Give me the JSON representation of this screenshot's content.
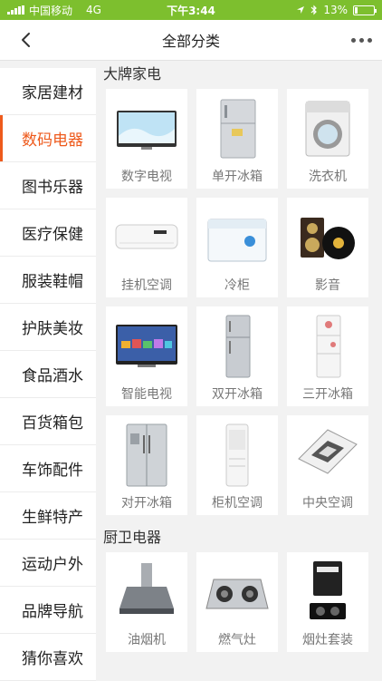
{
  "status_bar": {
    "carrier": "中国移动",
    "network": "4G",
    "time": "下午3:44",
    "battery": "13%",
    "battery_level": 0.13
  },
  "header": {
    "title": "全部分类"
  },
  "sidebar": {
    "items": [
      {
        "label": "家居建材"
      },
      {
        "label": "数码电器"
      },
      {
        "label": "图书乐器"
      },
      {
        "label": "医疗保健"
      },
      {
        "label": "服装鞋帽"
      },
      {
        "label": "护肤美妆"
      },
      {
        "label": "食品酒水"
      },
      {
        "label": "百货箱包"
      },
      {
        "label": "车饰配件"
      },
      {
        "label": "生鲜特产"
      },
      {
        "label": "运动户外"
      },
      {
        "label": "品牌导航"
      },
      {
        "label": "猜你喜欢"
      }
    ],
    "active_index": 1
  },
  "sections": [
    {
      "title": "大牌家电",
      "items": [
        {
          "label": "数字电视",
          "icon": "tv-icon"
        },
        {
          "label": "单开冰箱",
          "icon": "single-fridge-icon"
        },
        {
          "label": "洗衣机",
          "icon": "washing-machine-icon"
        },
        {
          "label": "挂机空调",
          "icon": "wall-ac-icon"
        },
        {
          "label": "冷柜",
          "icon": "chest-freezer-icon"
        },
        {
          "label": "影音",
          "icon": "speaker-icon"
        },
        {
          "label": "智能电视",
          "icon": "smart-tv-icon"
        },
        {
          "label": "双开冰箱",
          "icon": "double-fridge-icon"
        },
        {
          "label": "三开冰箱",
          "icon": "triple-fridge-icon"
        },
        {
          "label": "对开冰箱",
          "icon": "side-by-side-fridge-icon"
        },
        {
          "label": "柜机空调",
          "icon": "floor-ac-icon"
        },
        {
          "label": "中央空调",
          "icon": "ceiling-ac-icon"
        }
      ]
    },
    {
      "title": "厨卫电器",
      "items": [
        {
          "label": "油烟机",
          "icon": "range-hood-icon"
        },
        {
          "label": "燃气灶",
          "icon": "gas-stove-icon"
        },
        {
          "label": "烟灶套装",
          "icon": "hood-stove-set-icon"
        }
      ]
    }
  ],
  "colors": {
    "status_bar": "#7dbf2e",
    "accent": "#ee5a1c"
  }
}
